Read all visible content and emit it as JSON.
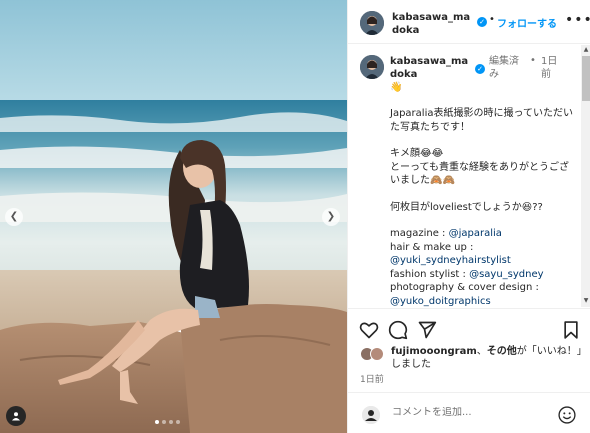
{
  "post": {
    "username": "kabasawa_madoka",
    "username_caption": "kabasawa_madoka",
    "follow_label": "フォローする",
    "separator": "•",
    "more": "•••",
    "edited": "編集済み",
    "caption_time": "1日前",
    "hand_emoji": "👋",
    "caption_lines": [
      "Japaralia表紙撮影の時に撮っていただいた写真たちです！",
      "",
      "キメ顔😂😂",
      "とーっても貴重な経験をありがとうございました🙈🙈",
      "",
      "何枚目がloveliestでしょうか😆??",
      ""
    ],
    "credits": [
      {
        "label": "magazine : ",
        "handle": "@japaralia"
      },
      {
        "label": "hair & make up : ",
        "handle": "@yuki_sydneyhairstylist"
      },
      {
        "label": "fashion stylist : ",
        "handle": "@sayu_sydney"
      },
      {
        "label": "photography & cover design : ",
        "handle": "@yuko_doitgraphics"
      }
    ]
  },
  "likes": {
    "liker": "fujimooongram",
    "middle": "、",
    "others": "その他",
    "suffix": "が「いいね！」しました"
  },
  "time_ago": "1日前",
  "comment": {
    "placeholder": "コメントを追加..."
  },
  "colors": {
    "accent": "#0095f6",
    "link": "#00376b",
    "text": "#262626",
    "muted": "#737373"
  },
  "icons": [
    "chevron-left-icon",
    "chevron-right-icon",
    "user-tag-icon",
    "verified-icon",
    "more-icon",
    "heart-icon",
    "comment-icon",
    "share-icon",
    "bookmark-icon",
    "smiley-icon"
  ]
}
